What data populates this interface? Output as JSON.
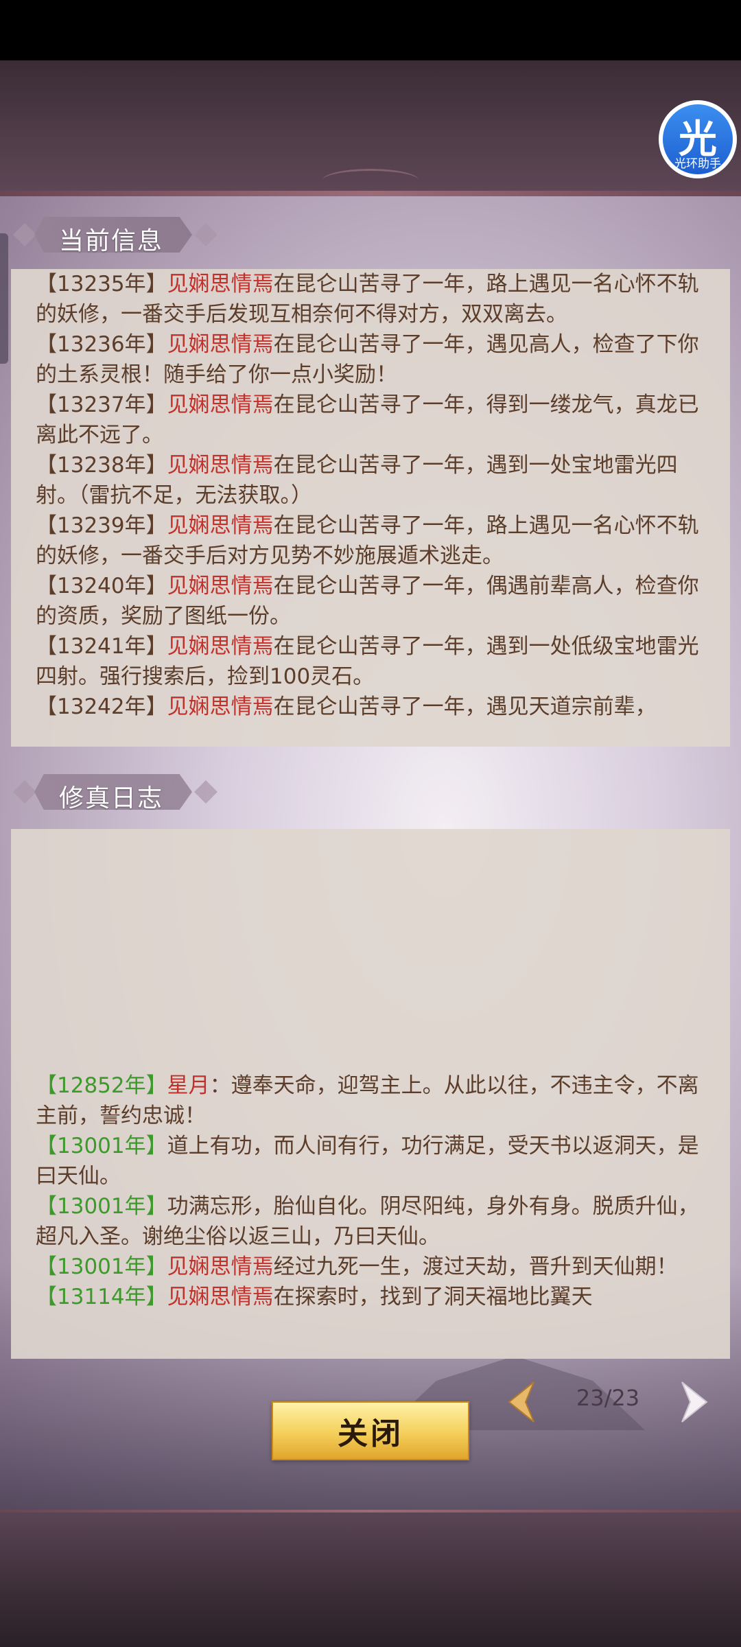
{
  "current_info": {
    "title": "当前信息",
    "entries": [
      {
        "year": "【13235年】",
        "name": "见娴思情焉",
        "text": "在昆仑山苦寻了一年，路上遇见一名心怀不轨的妖修，一番交手后发现互相奈何不得对方，双双离去。"
      },
      {
        "year": "【13236年】",
        "name": "见娴思情焉",
        "text": "在昆仑山苦寻了一年，遇见高人，检查了下你的土系灵根！随手给了你一点小奖励！"
      },
      {
        "year": "【13237年】",
        "name": "见娴思情焉",
        "text": "在昆仑山苦寻了一年，得到一缕龙气，真龙已离此不远了。"
      },
      {
        "year": "【13238年】",
        "name": "见娴思情焉",
        "text": "在昆仑山苦寻了一年，遇到一处宝地雷光四射。（雷抗不足，无法获取。）"
      },
      {
        "year": "【13239年】",
        "name": "见娴思情焉",
        "text": "在昆仑山苦寻了一年，路上遇见一名心怀不轨的妖修，一番交手后对方见势不妙施展遁术逃走。"
      },
      {
        "year": "【13240年】",
        "name": "见娴思情焉",
        "text": "在昆仑山苦寻了一年，偶遇前辈高人，检查你的资质，奖励了图纸一份。"
      },
      {
        "year": "【13241年】",
        "name": "见娴思情焉",
        "text": "在昆仑山苦寻了一年，遇到一处低级宝地雷光四射。强行搜索后，捡到100灵石。"
      },
      {
        "year": "【13242年】",
        "name": "见娴思情焉",
        "text": "在昆仑山苦寻了一年，遇见天道宗前辈，"
      }
    ]
  },
  "cultivation_log": {
    "title": "修真日志",
    "entries": [
      {
        "year": "【12852年】",
        "name": "星月",
        "text": "：遵奉天命，迎驾主上。从此以往，不违主令，不离主前，誓约忠诚！"
      },
      {
        "year": "【13001年】",
        "name": "",
        "text": "道上有功，而人间有行，功行满足，受天书以返洞天，是曰天仙。"
      },
      {
        "year": "【13001年】",
        "name": "",
        "text": "功满忘形，胎仙自化。阴尽阳纯，身外有身。脱质升仙，超凡入圣。谢绝尘俗以返三山，乃曰天仙。"
      },
      {
        "year": "【13001年】",
        "name": "见娴思情焉",
        "text": "经过九死一生，渡过天劫，晋升到天仙期！"
      },
      {
        "year": "【13114年】",
        "name": "见娴思情焉",
        "text": "在探索时，找到了洞天福地比翼天"
      }
    ]
  },
  "helper": {
    "glyph": "光",
    "label": "光环助手"
  },
  "footer": {
    "close_label": "关闭",
    "page": "23/23"
  },
  "colors": {
    "year_green": "#3c9a2a",
    "name_red": "#c0312b",
    "text_brown": "#5b3d2a"
  }
}
